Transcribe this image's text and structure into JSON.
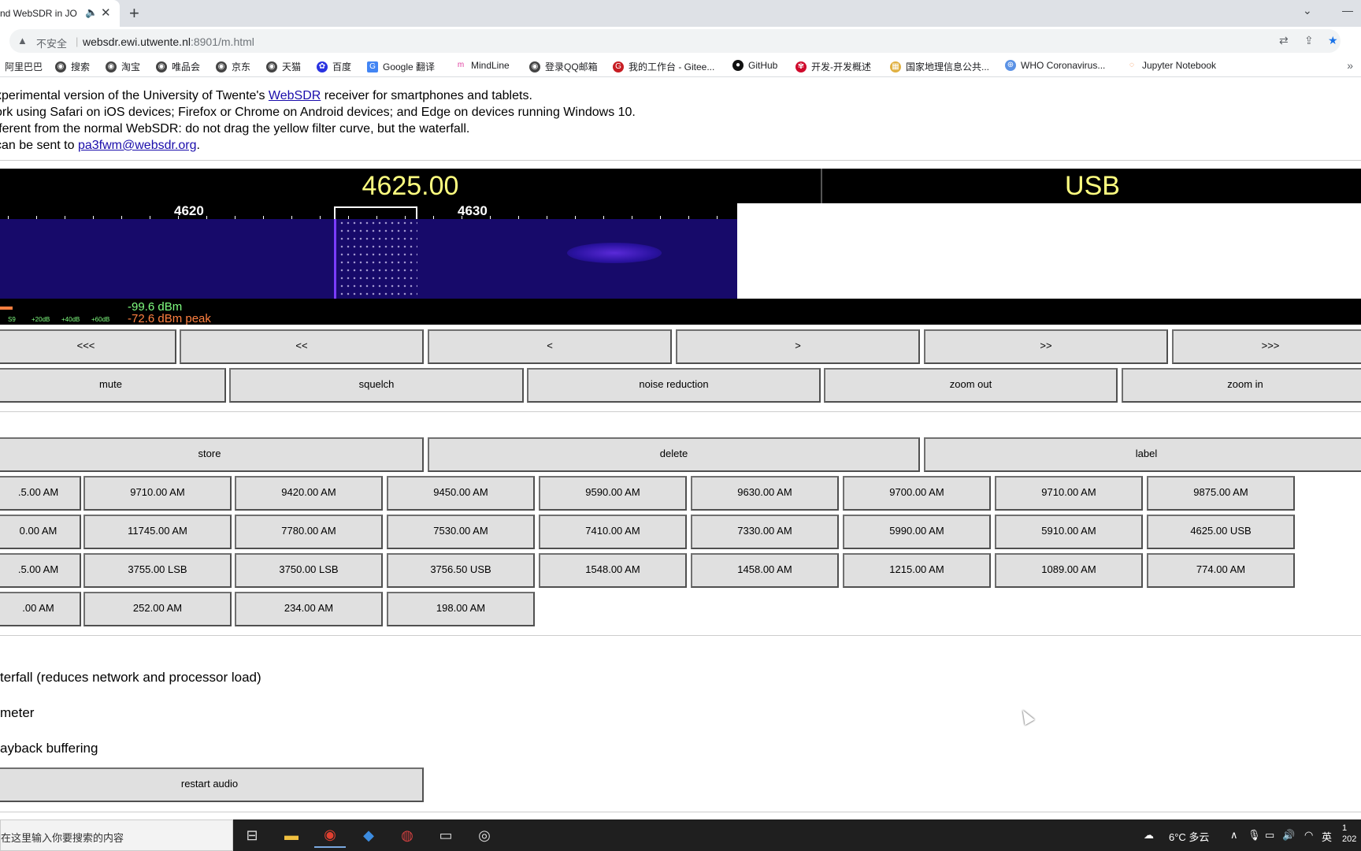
{
  "browser": {
    "tab_title": "nd WebSDR in JO",
    "url_warning": "不安全",
    "url_host": "websdr.ewi.utwente.nl",
    "url_path": ":8901/m.html",
    "bookmarks": [
      "阿里巴巴",
      "搜索",
      "淘宝",
      "唯品会",
      "京东",
      "天猫",
      "百度",
      "Google 翻译",
      "MindLine",
      "登录QQ邮箱",
      "我的工作台 - Gitee...",
      "GitHub",
      "开发-开发概述",
      "国家地理信息公共...",
      "WHO Coronavirus...",
      "Jupyter Notebook"
    ],
    "bookmarks_more": "»"
  },
  "intro": {
    "line1_pre": "xperimental version of the University of Twente's ",
    "line1_link": "WebSDR",
    "line1_post": " receiver for smartphones and tablets.",
    "line2": "ork using Safari on iOS devices; Firefox or Chrome on Android devices; and Edge on devices running Windows 10.",
    "line3": "fferent from the normal WebSDR: do not drag the yellow filter curve, but the waterfall.",
    "line4_pre": "can be sent to ",
    "line4_link": "pa3fwm@websdr.org",
    "line4_post": "."
  },
  "receiver": {
    "frequency": "4625.00",
    "mode": "USB",
    "scale_labels": [
      "4620",
      "4630"
    ],
    "smeter_dbm": "-99.6 dBm",
    "smeter_peak": "-72.6 dBm peak",
    "smeter_marks": [
      "S9",
      "+20dB",
      "+40dB",
      "+60dB"
    ]
  },
  "tuning": [
    "<<<",
    "<<",
    "<",
    ">",
    ">>",
    ">>>"
  ],
  "controls": [
    "mute",
    "squelch",
    "noise reduction",
    "zoom out",
    "zoom in"
  ],
  "memory_actions": [
    "store",
    "delete",
    "label"
  ],
  "memories": [
    [
      ".5.00 AM",
      "9710.00 AM",
      "9420.00 AM",
      "9450.00 AM",
      "9590.00 AM",
      "9630.00 AM",
      "9700.00 AM",
      "9710.00 AM",
      "9875.00 AM"
    ],
    [
      "0.00 AM",
      "11745.00 AM",
      "7780.00 AM",
      "7530.00 AM",
      "7410.00 AM",
      "7330.00 AM",
      "5990.00 AM",
      "5910.00 AM",
      "4625.00 USB"
    ],
    [
      ".5.00 AM",
      "3755.00 LSB",
      "3750.00 LSB",
      "3756.50 USB",
      "1548.00 AM",
      "1458.00 AM",
      "1215.00 AM",
      "1089.00 AM",
      "774.00 AM"
    ],
    [
      ".00 AM",
      "252.00 AM",
      "234.00 AM",
      "198.00 AM"
    ]
  ],
  "options": [
    "terfall (reduces network and processor load)",
    "meter",
    "ayback buffering"
  ],
  "restart_audio": "restart audio",
  "taskbar": {
    "search_text": "在这里输入你要搜索的内容",
    "weather": "6°C 多云",
    "ime": "英",
    "clock": "1\n202"
  }
}
